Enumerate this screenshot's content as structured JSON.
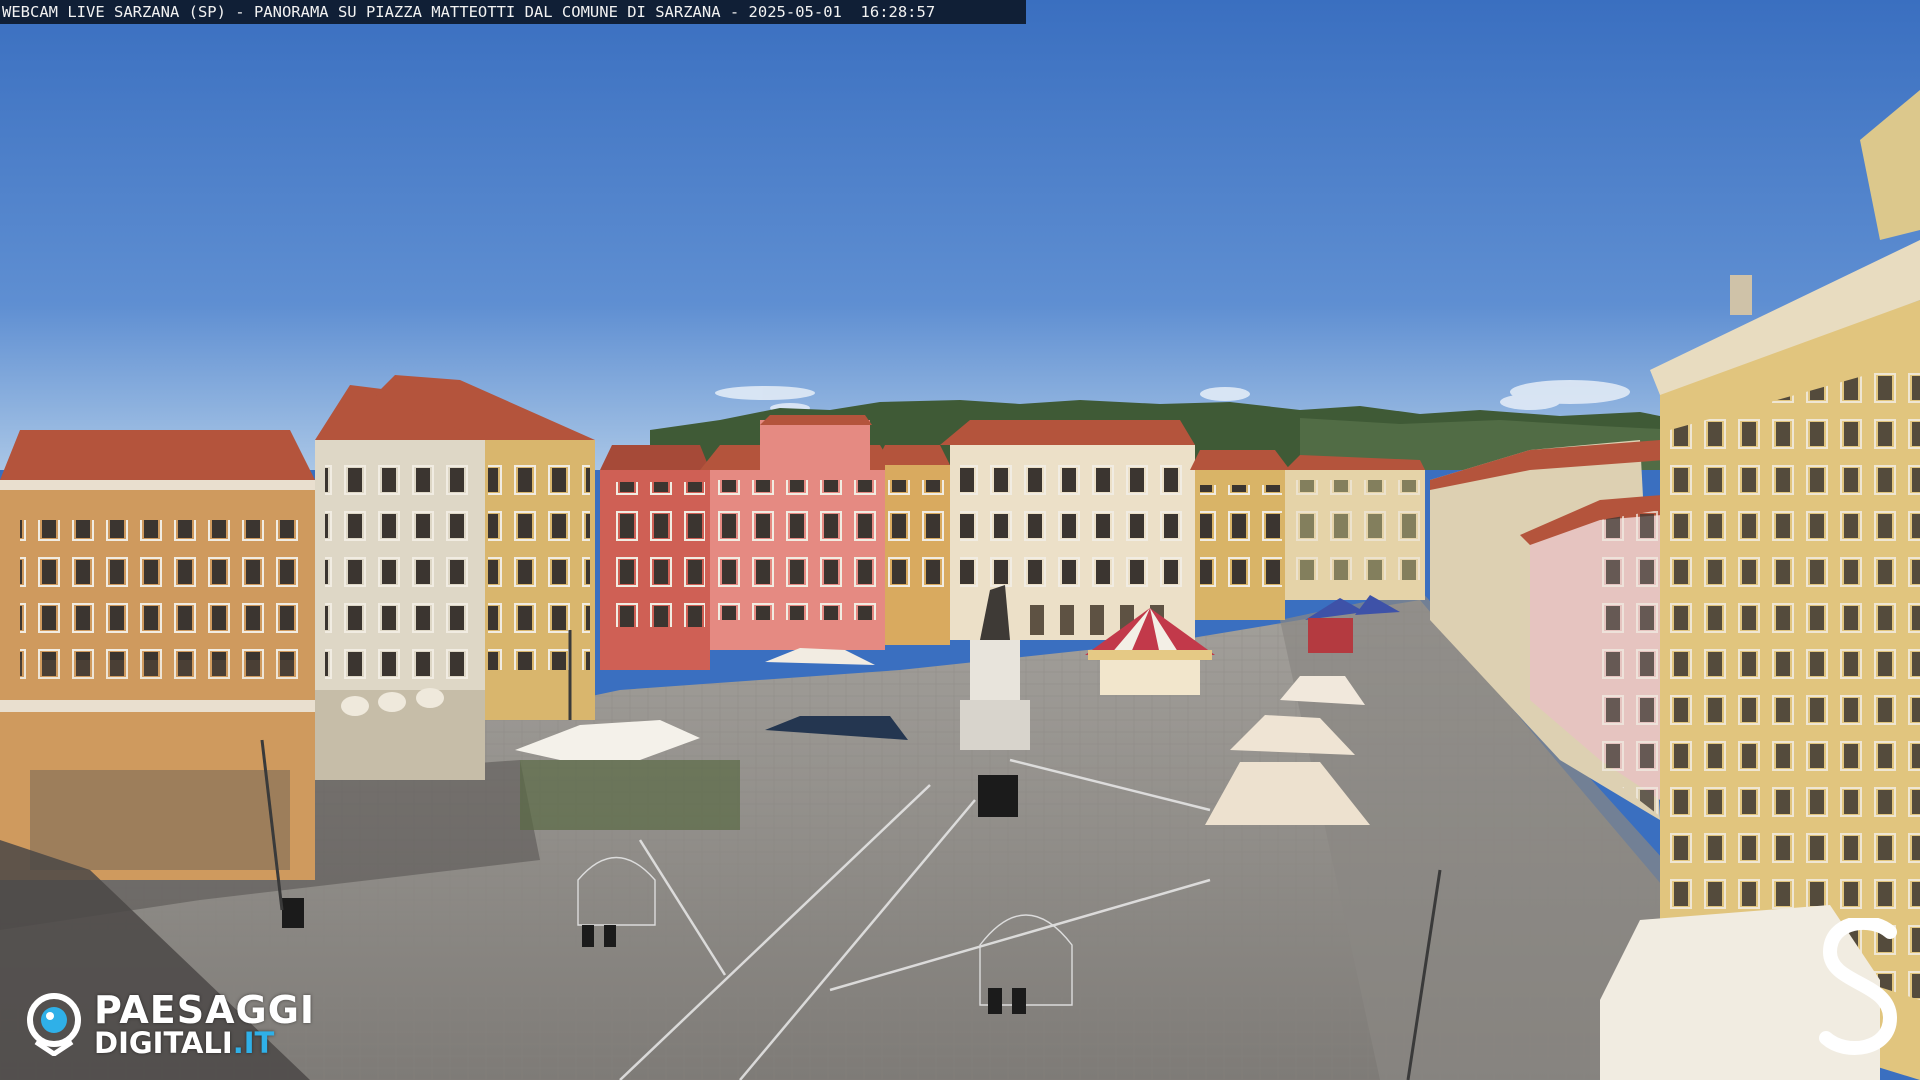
{
  "overlay": {
    "caption": "WEBCAM LIVE SARZANA (SP) - PANORAMA SU PIAZZA MATTEOTTI DAL COMUNE DI SARZANA - 2025-05-01  16:28:57"
  },
  "logo": {
    "line1": "PAESAGGI",
    "line2_main": "DIGITALI",
    "line2_tld": ".IT",
    "icon": "eye-icon",
    "brand_color": "#2fb0e8"
  },
  "corner_mark": {
    "icon": "s-monogram-icon"
  },
  "colors": {
    "sky_top": "#3a6fc0",
    "sky_bottom": "#9cbfe4",
    "pavement": "#8f8c88"
  }
}
